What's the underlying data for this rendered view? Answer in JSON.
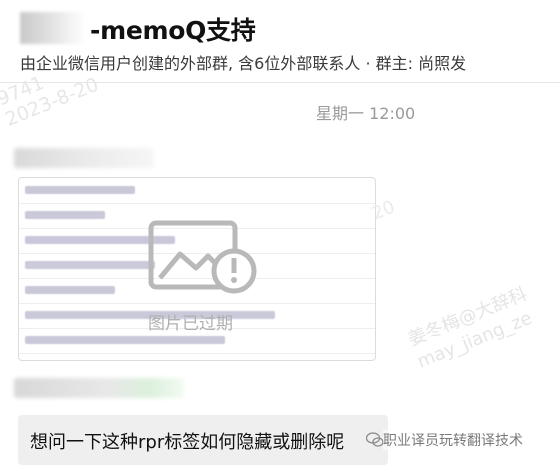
{
  "header": {
    "title": "-memoQ支持",
    "subtitle": "由企业微信用户创建的外部群, 含6位外部联系人 · 群主: 尚照发"
  },
  "watermarks": {
    "top_left_line1": "9741",
    "top_left_line2": "2023-8-20",
    "middle": "20",
    "bottom_right_line1": "姜冬梅@大辞科",
    "bottom_right_line2": "may_jiang_ze"
  },
  "chat": {
    "timestamp": "星期一 12:00",
    "messages": [
      {
        "type": "image",
        "status_label": "图片已过期",
        "rows": 7
      },
      {
        "type": "text",
        "text": "想问一下这种rpr标签如何隐藏或删除呢"
      }
    ]
  },
  "source_tag": "职业译员玩转翻译技术",
  "colors": {
    "bubble": "#efefef",
    "expired_icon": "#b9b9b9",
    "wechat_green": "#07c160"
  }
}
